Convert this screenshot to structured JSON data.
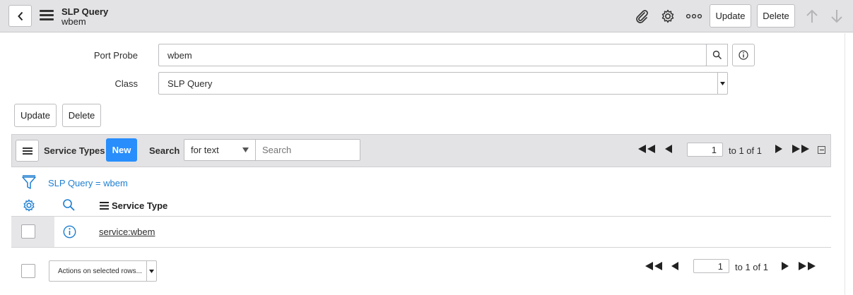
{
  "header": {
    "title": "SLP Query",
    "subtitle": "wbem",
    "update_label": "Update",
    "delete_label": "Delete"
  },
  "form": {
    "port_probe_label": "Port Probe",
    "port_probe_value": "wbem",
    "class_label": "Class",
    "class_value": "SLP Query",
    "update_label": "Update",
    "delete_label": "Delete"
  },
  "related_list": {
    "title": "Service Types",
    "new_label": "New",
    "search_label": "Search",
    "search_field_value": "for text",
    "search_placeholder": "Search",
    "page_value": "1",
    "page_range": "to 1 of 1",
    "filter_text": "SLP Query = wbem",
    "column_header": "Service Type",
    "rows": [
      {
        "service_type": "service:wbem"
      }
    ],
    "actions_label": "Actions on selected rows...",
    "bottom_page_value": "1",
    "bottom_page_range": "to 1 of 1"
  },
  "colors": {
    "accent": "#278efc",
    "link": "#1f7fd1",
    "header_bg": "#e3e3e5"
  }
}
